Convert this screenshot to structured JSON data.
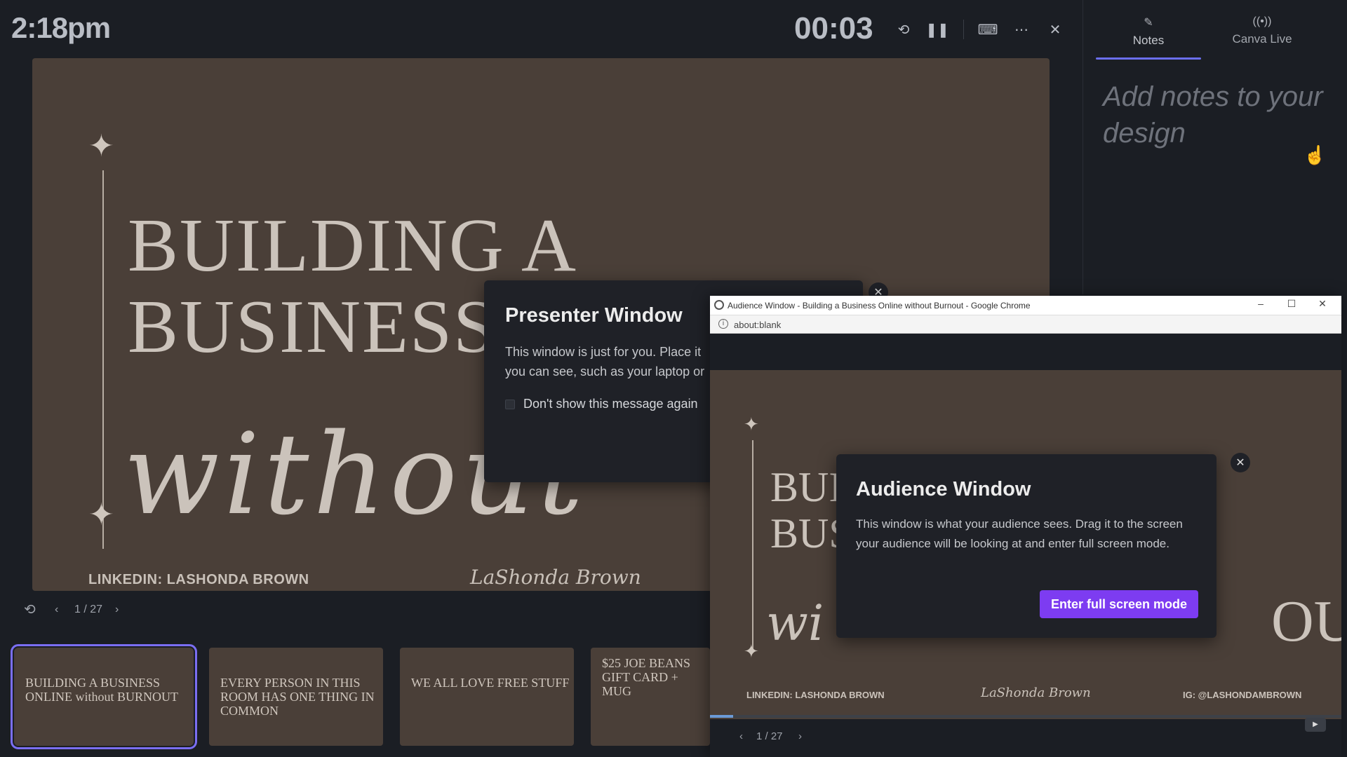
{
  "header": {
    "clock": "2:18pm",
    "timer": "00:03",
    "icons": [
      "restart-timer-icon",
      "pause-icon",
      "keyboard-icon",
      "more-icon",
      "close-icon"
    ]
  },
  "notes_panel": {
    "tabs": [
      {
        "label": "Notes",
        "icon": "notes-icon"
      },
      {
        "label": "Canva Live",
        "icon": "broadcast-icon"
      }
    ],
    "placeholder": "Add notes to your design"
  },
  "slide": {
    "title_line1": "BUILDING A",
    "title_line2": "BUSINESS",
    "script": "without",
    "linkedin": "LINKEDIN: LASHONDA BROWN",
    "signature": "LaShonda Brown",
    "page_indicator": "1 / 27"
  },
  "thumbnails": [
    {
      "text": "BUILDING A BUSINESS ONLINE without BURNOUT"
    },
    {
      "text": "EVERY PERSON IN THIS ROOM HAS ONE THING IN COMMON"
    },
    {
      "text": "WE ALL LOVE FREE STUFF"
    },
    {
      "text": "$25 JOE BEANS GIFT CARD + MUG"
    }
  ],
  "presenter_dialog": {
    "title": "Presenter Window",
    "body_line1": "This window is just for you. Place it",
    "body_line2": "you can see, such as your laptop or",
    "checkbox_label": "Don't show this message again"
  },
  "audience_window": {
    "window_title": "Audience Window - Building a Business Online without Burnout - Google Chrome",
    "url": "about:blank",
    "slide_title_line1": "BUI",
    "slide_title_line2": "BUS",
    "slide_script": "wi",
    "slide_out": "OUT",
    "footer_linkedin": "LINKEDIN: LASHONDA BROWN",
    "footer_signature": "LaShonda Brown",
    "footer_ig": "IG: @LASHONDAMBROWN",
    "page_indicator": "1 / 27",
    "progress": 0.037,
    "dialog": {
      "title": "Audience Window",
      "body": "This window is what your audience sees. Drag it to the screen your audience will be looking at and enter full screen mode.",
      "button": "Enter full screen mode"
    }
  },
  "colors": {
    "background": "#1b1e24",
    "slide_bg": "#4a3f38",
    "accent_purple": "#7d3cf1",
    "tab_underline": "#6b6ff0"
  }
}
